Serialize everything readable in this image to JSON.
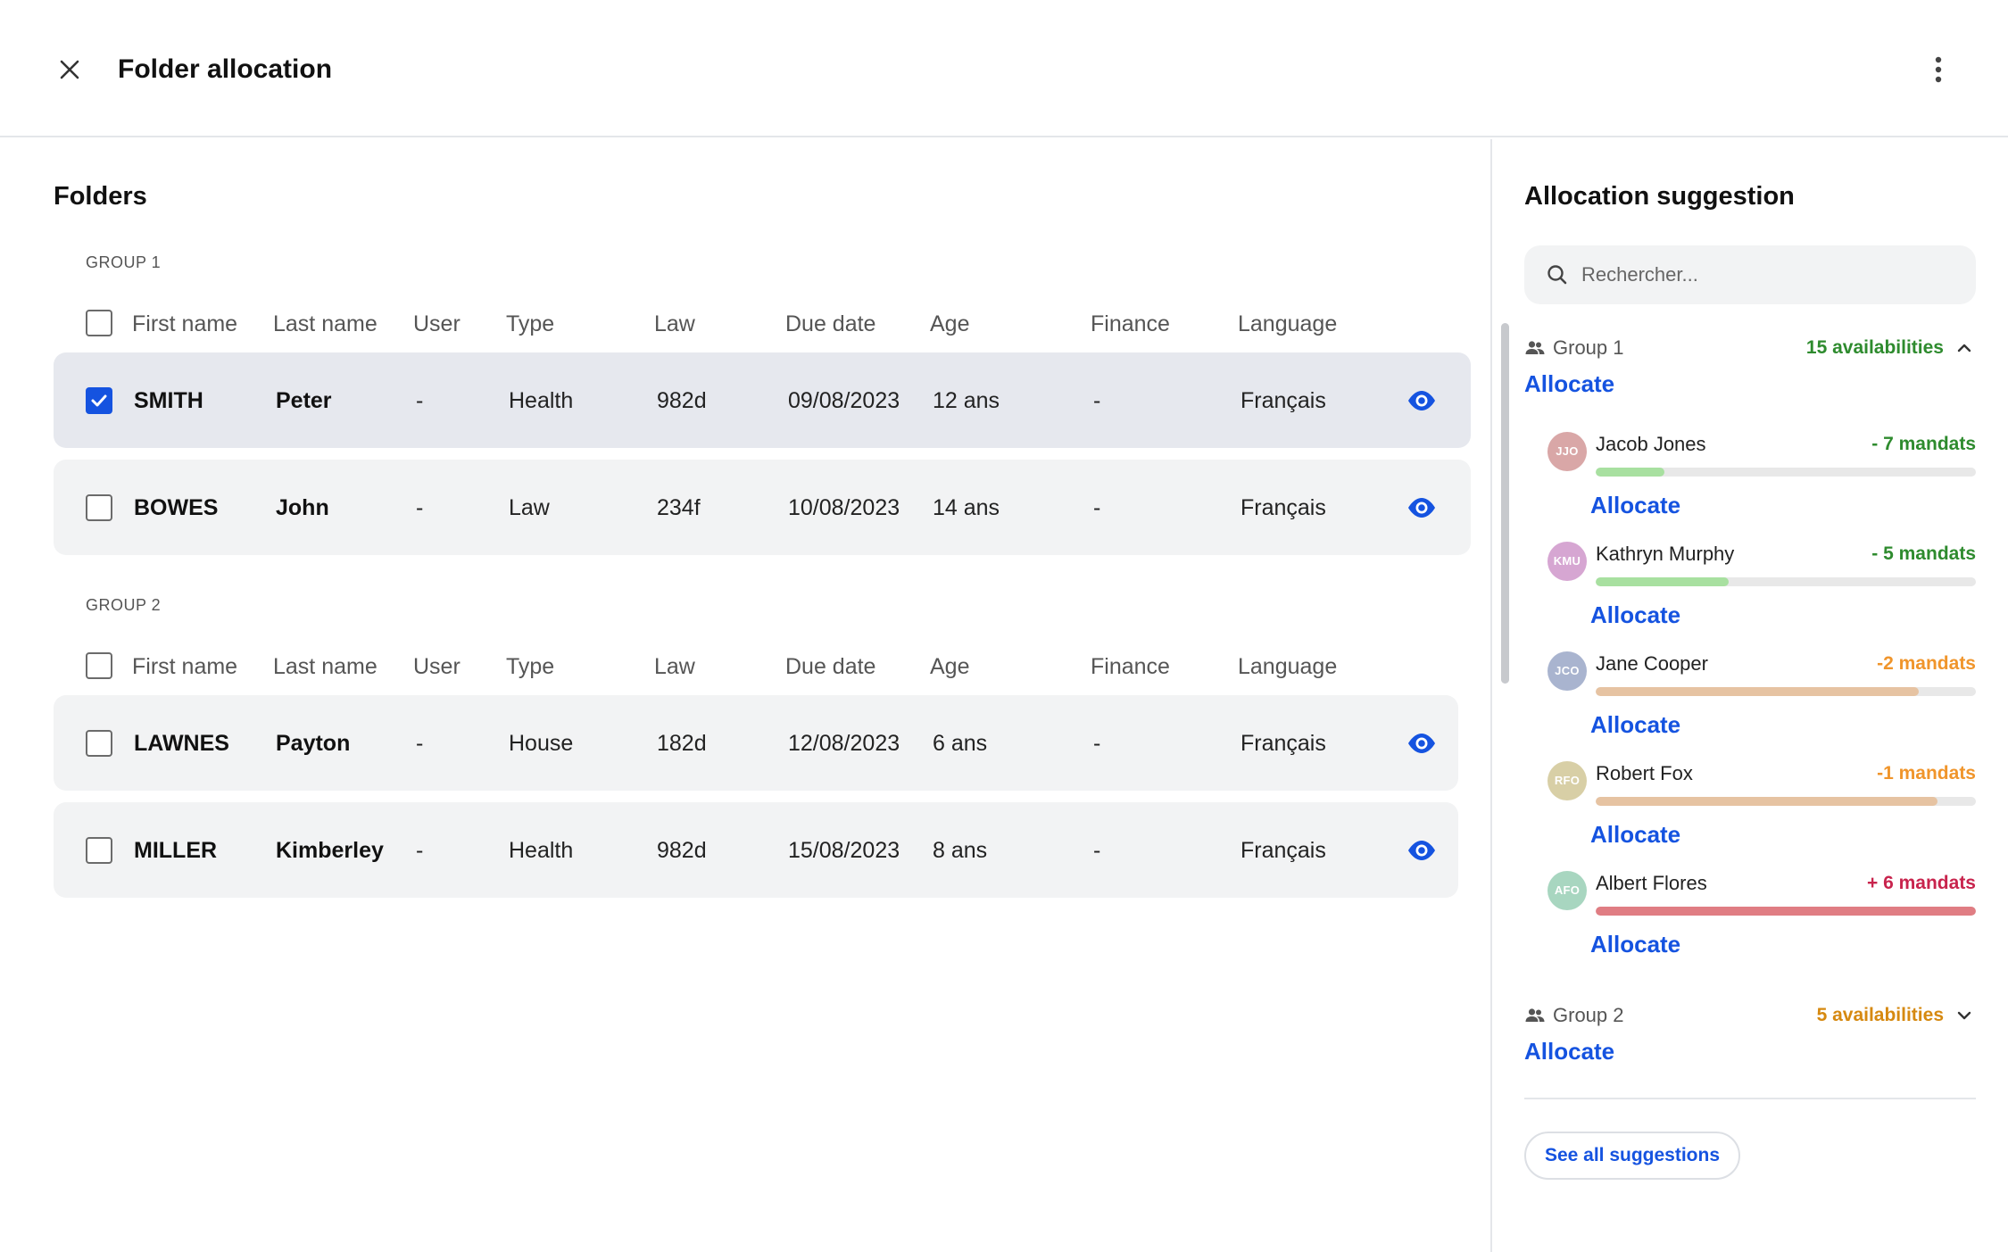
{
  "header": {
    "title": "Folder allocation"
  },
  "folders": {
    "title": "Folders",
    "columns": [
      "First name",
      "Last name",
      "User",
      "Type",
      "Law",
      "Due date",
      "Age",
      "Finance",
      "Language"
    ],
    "groups": [
      {
        "label": "GROUP 1",
        "rows": [
          {
            "first": "SMITH",
            "last": "Peter",
            "user": "-",
            "type": "Health",
            "law": "982d",
            "due": "09/08/2023",
            "age": "12 ans",
            "finance": "-",
            "language": "Français",
            "checked": true
          },
          {
            "first": "BOWES",
            "last": "John",
            "user": "-",
            "type": "Law",
            "law": "234f",
            "due": "10/08/2023",
            "age": "14 ans",
            "finance": "-",
            "language": "Français",
            "checked": false
          }
        ]
      },
      {
        "label": "GROUP 2",
        "rows": [
          {
            "first": "LAWNES",
            "last": "Payton",
            "user": "-",
            "type": "House",
            "law": "182d",
            "due": "12/08/2023",
            "age": "6 ans",
            "finance": "-",
            "language": "Français",
            "checked": false
          },
          {
            "first": "MILLER",
            "last": "Kimberley",
            "user": "-",
            "type": "Health",
            "law": "982d",
            "due": "15/08/2023",
            "age": "8 ans",
            "finance": "-",
            "language": "Français",
            "checked": false
          }
        ]
      }
    ]
  },
  "suggestions": {
    "title": "Allocation suggestion",
    "search_placeholder": "Rechercher...",
    "allocate_label": "Allocate",
    "groups": [
      {
        "name": "Group 1",
        "availability": "15 availabilities",
        "availability_color": "#2e8b2e",
        "expanded": true,
        "members": [
          {
            "initials": "JJO",
            "name": "Jacob Jones",
            "count": "- 7 mandats",
            "count_color": "#2e8b2e",
            "avatar_color": "#d9a7a7",
            "bar_color": "#a8e0a0",
            "load": 0.18
          },
          {
            "initials": "KMU",
            "name": "Kathryn Murphy",
            "count": "- 5 mandats",
            "count_color": "#2e8b2e",
            "avatar_color": "#d6a6d2",
            "bar_color": "#a8e0a0",
            "load": 0.35
          },
          {
            "initials": "JCO",
            "name": "Jane Cooper",
            "count": "-2 mandats",
            "count_color": "#f0952b",
            "avatar_color": "#a9b4cf",
            "bar_color": "#e6c3a2",
            "load": 0.85
          },
          {
            "initials": "RFO",
            "name": "Robert Fox",
            "count": "-1 mandats",
            "count_color": "#f0952b",
            "avatar_color": "#d8cfa6",
            "bar_color": "#e6c3a2",
            "load": 0.9
          },
          {
            "initials": "AFO",
            "name": "Albert Flores",
            "count": "+ 6 mandats",
            "count_color": "#c8244d",
            "avatar_color": "#a8d6c0",
            "bar_color": "#e07d83",
            "load": 1.0
          }
        ]
      },
      {
        "name": "Group 2",
        "availability": "5 availabilities",
        "availability_color": "#d68910",
        "expanded": false,
        "members": []
      }
    ],
    "see_all_label": "See all suggestions"
  },
  "colors": {
    "accent": "#1553e0",
    "selected_row": "#e6e8ee",
    "row": "#f2f3f4"
  }
}
